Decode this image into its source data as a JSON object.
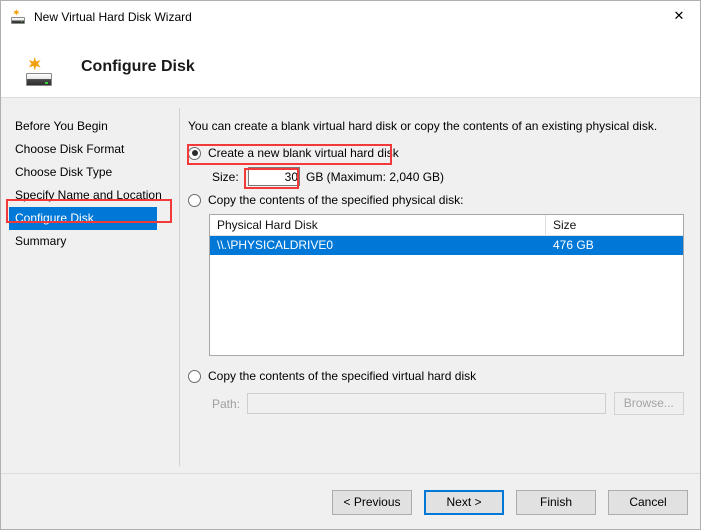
{
  "window": {
    "title": "New Virtual Hard Disk Wizard",
    "close_label": "✕",
    "icon": "new-hard-disk-icon"
  },
  "header": {
    "title": "Configure Disk",
    "icon": "new-hard-disk-icon"
  },
  "sidebar": {
    "items": [
      {
        "label": "Before You Begin",
        "selected": false
      },
      {
        "label": "Choose Disk Format",
        "selected": false
      },
      {
        "label": "Choose Disk Type",
        "selected": false
      },
      {
        "label": "Specify Name and Location",
        "selected": false
      },
      {
        "label": "Configure Disk",
        "selected": true
      },
      {
        "label": "Summary",
        "selected": false
      }
    ]
  },
  "main": {
    "intro": "You can create a blank virtual hard disk or copy the contents of an existing physical disk.",
    "option_blank": {
      "label": "Create a new blank virtual hard disk",
      "checked": true
    },
    "size": {
      "label": "Size:",
      "value": "30",
      "placeholder": "",
      "suffix": "GB (Maximum: 2,040 GB)"
    },
    "option_physical": {
      "label": "Copy the contents of the specified physical disk:",
      "checked": false
    },
    "disk_table": {
      "columns": [
        "Physical Hard Disk",
        "Size"
      ],
      "rows": [
        {
          "name": "\\\\.\\PHYSICALDRIVE0",
          "size": "476 GB",
          "selected": true
        }
      ]
    },
    "option_virtual": {
      "label": "Copy the contents of the specified virtual hard disk",
      "checked": false
    },
    "path": {
      "label": "Path:",
      "value": "",
      "placeholder": "",
      "browse_label": "Browse...",
      "disabled": true
    }
  },
  "footer": {
    "previous_label": "< Previous",
    "next_label": "Next >",
    "finish_label": "Finish",
    "cancel_label": "Cancel"
  },
  "colors": {
    "accent": "#0078d7",
    "annotation": "#f4393a",
    "body": "#f0f0f0",
    "disabled_text": "#a0a0a0"
  }
}
